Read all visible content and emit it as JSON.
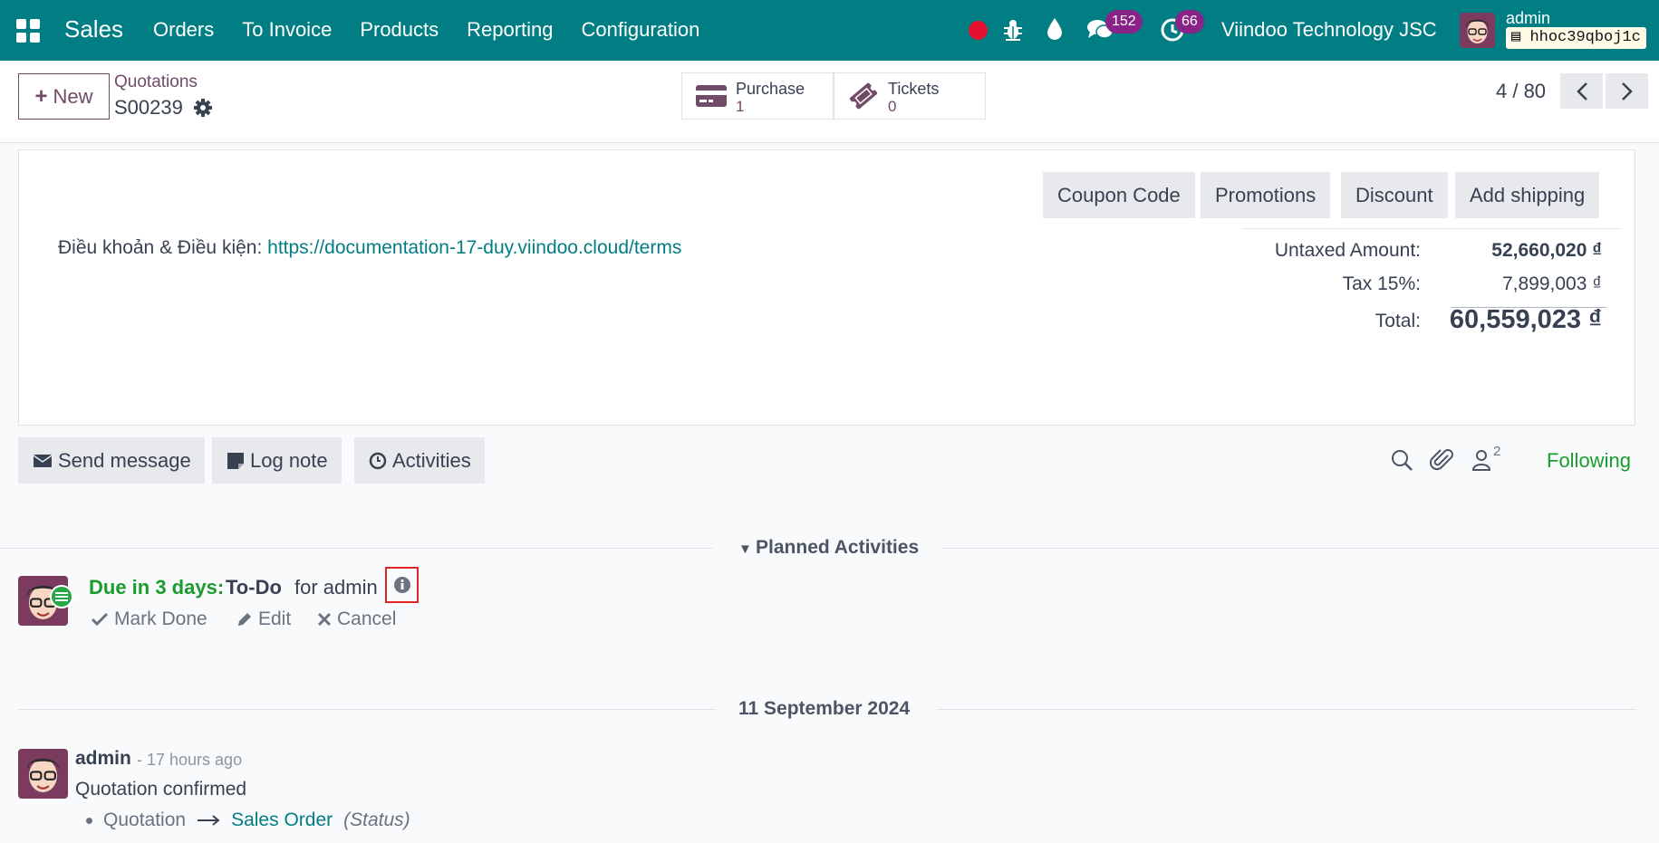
{
  "navbar": {
    "app_name": "Sales",
    "menu": [
      "Orders",
      "To Invoice",
      "Products",
      "Reporting",
      "Configuration"
    ],
    "messages_count": "152",
    "activities_count": "66",
    "company": "Viindoo Technology JSC",
    "user": "admin",
    "database": "hhoc39qboj1c",
    "accent_color": "#017e84"
  },
  "control": {
    "new_label": "New",
    "breadcrumb_parent": "Quotations",
    "record_name": "S00239",
    "smart_buttons": [
      {
        "label": "Purchase",
        "value": "1",
        "icon": "credit-card-icon"
      },
      {
        "label": "Tickets",
        "value": "0",
        "icon": "ticket-icon"
      }
    ],
    "pager": "4 / 80"
  },
  "sheet": {
    "actions": [
      "Coupon Code",
      "Promotions",
      "Discount",
      "Add shipping"
    ],
    "terms_label": "Điều khoản & Điều kiện:",
    "terms_link": "https://documentation-17-duy.viindoo.cloud/terms",
    "totals": {
      "untaxed_label": "Untaxed Amount:",
      "untaxed_value": "52,660,020 ₫",
      "tax_label": "Tax 15%:",
      "tax_value": "7,899,003 ₫",
      "total_label": "Total:",
      "total_value": "60,559,023 ₫"
    }
  },
  "chatter": {
    "send_message": "Send message",
    "log_note": "Log note",
    "activities": "Activities",
    "followers_count": "2",
    "following": "Following",
    "planned_title": "Planned Activities",
    "activity": {
      "due": "Due in 3 days:",
      "type": "To-Do",
      "assignee": "for admin",
      "mark_done": "Mark Done",
      "edit": "Edit",
      "cancel": "Cancel"
    },
    "date_separator": "11 September 2024",
    "message": {
      "author": "admin",
      "time": "- 17 hours ago",
      "body": "Quotation confirmed",
      "old_value": "Quotation",
      "new_value": "Sales Order",
      "field": "(Status)"
    }
  }
}
